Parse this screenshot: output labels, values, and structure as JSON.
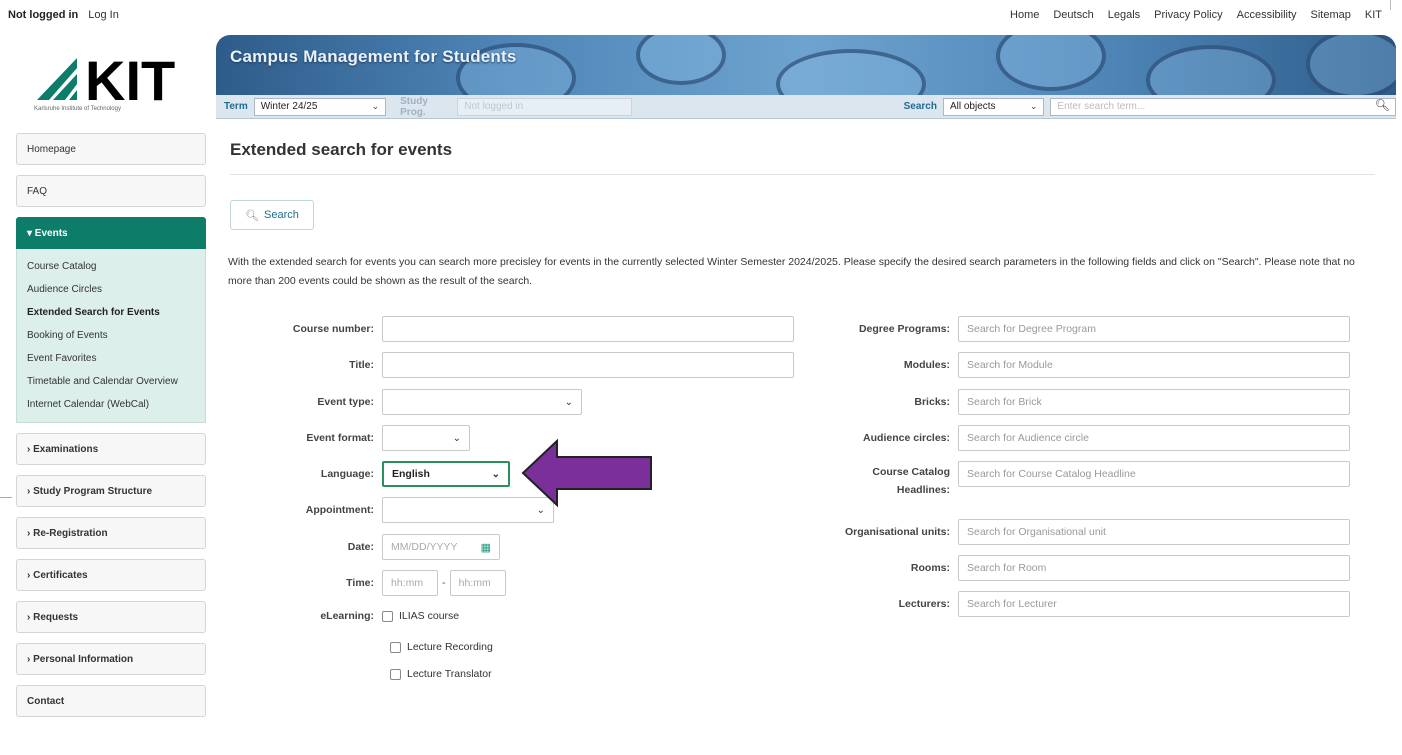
{
  "topbar": {
    "status": "Not logged in",
    "login": "Log In",
    "links": [
      "Home",
      "Deutsch",
      "Legals",
      "Privacy Policy",
      "Accessibility",
      "Sitemap",
      "KIT"
    ]
  },
  "brand": {
    "logo_text": "KIT",
    "logo_sub": "Karlsruhe Institute of Technology",
    "banner_title": "Campus Management for Students"
  },
  "header_search": {
    "term_label": "Term",
    "term_value": "Winter 24/25",
    "study_prog_label": "Study Prog.",
    "study_prog_value": "Not logged in",
    "search_label": "Search",
    "search_scope": "All objects",
    "search_placeholder": "Enter search term..."
  },
  "sidebar": {
    "items_top": [
      "Homepage",
      "FAQ"
    ],
    "active_group": "▾ Events",
    "sub_items": [
      "Course Catalog",
      "Audience Circles",
      "Extended Search for Events",
      "Booking of Events",
      "Event Favorites",
      "Timetable and Calendar Overview",
      "Internet Calendar (WebCal)"
    ],
    "groups": [
      "› Examinations",
      "› Study Program Structure",
      "› Re-Registration",
      "› Certificates",
      "› Requests",
      "› Personal Information"
    ],
    "contact": "Contact"
  },
  "main": {
    "title": "Extended search for events",
    "search_button": "Search",
    "intro": "With the extended search for events you can search more precisley for events in the currently selected Winter Semester 2024/2025. Please specify the desired search parameters in the following fields and click on \"Search\". Please note that no more than 200 events could be shown as the result of the search."
  },
  "form_left": {
    "course_number_label": "Course number:",
    "title_label": "Title:",
    "event_type_label": "Event type:",
    "event_format_label": "Event format:",
    "language_label": "Language:",
    "language_value": "English",
    "appointment_label": "Appointment:",
    "date_label": "Date:",
    "date_placeholder": "MM/DD/YYYY",
    "time_label": "Time:",
    "time_from": "hh:mm",
    "time_sep": "-",
    "time_to": "hh:mm",
    "elearning_label": "eLearning:",
    "elearning_options": [
      "ILIAS course",
      "Lecture Recording",
      "Lecture Translator"
    ]
  },
  "form_right": {
    "degree_label": "Degree Programs:",
    "degree_placeholder": "Search for Degree Program",
    "modules_label": "Modules:",
    "modules_placeholder": "Search for Module",
    "bricks_label": "Bricks:",
    "bricks_placeholder": "Search for Brick",
    "audience_label": "Audience circles:",
    "audience_placeholder": "Search for Audience circle",
    "catalog_label_1": "Course Catalog",
    "catalog_label_2": "Headlines:",
    "catalog_placeholder": "Search for Course Catalog Headline",
    "org_label": "Organisational units:",
    "org_placeholder": "Search for Organisational unit",
    "rooms_label": "Rooms:",
    "rooms_placeholder": "Search for Room",
    "lecturers_label": "Lecturers:",
    "lecturers_placeholder": "Search for Lecturer"
  },
  "colors": {
    "accent": "#0d7d6a",
    "arrow": "#7a2f9a",
    "link": "#1f6b8f"
  }
}
